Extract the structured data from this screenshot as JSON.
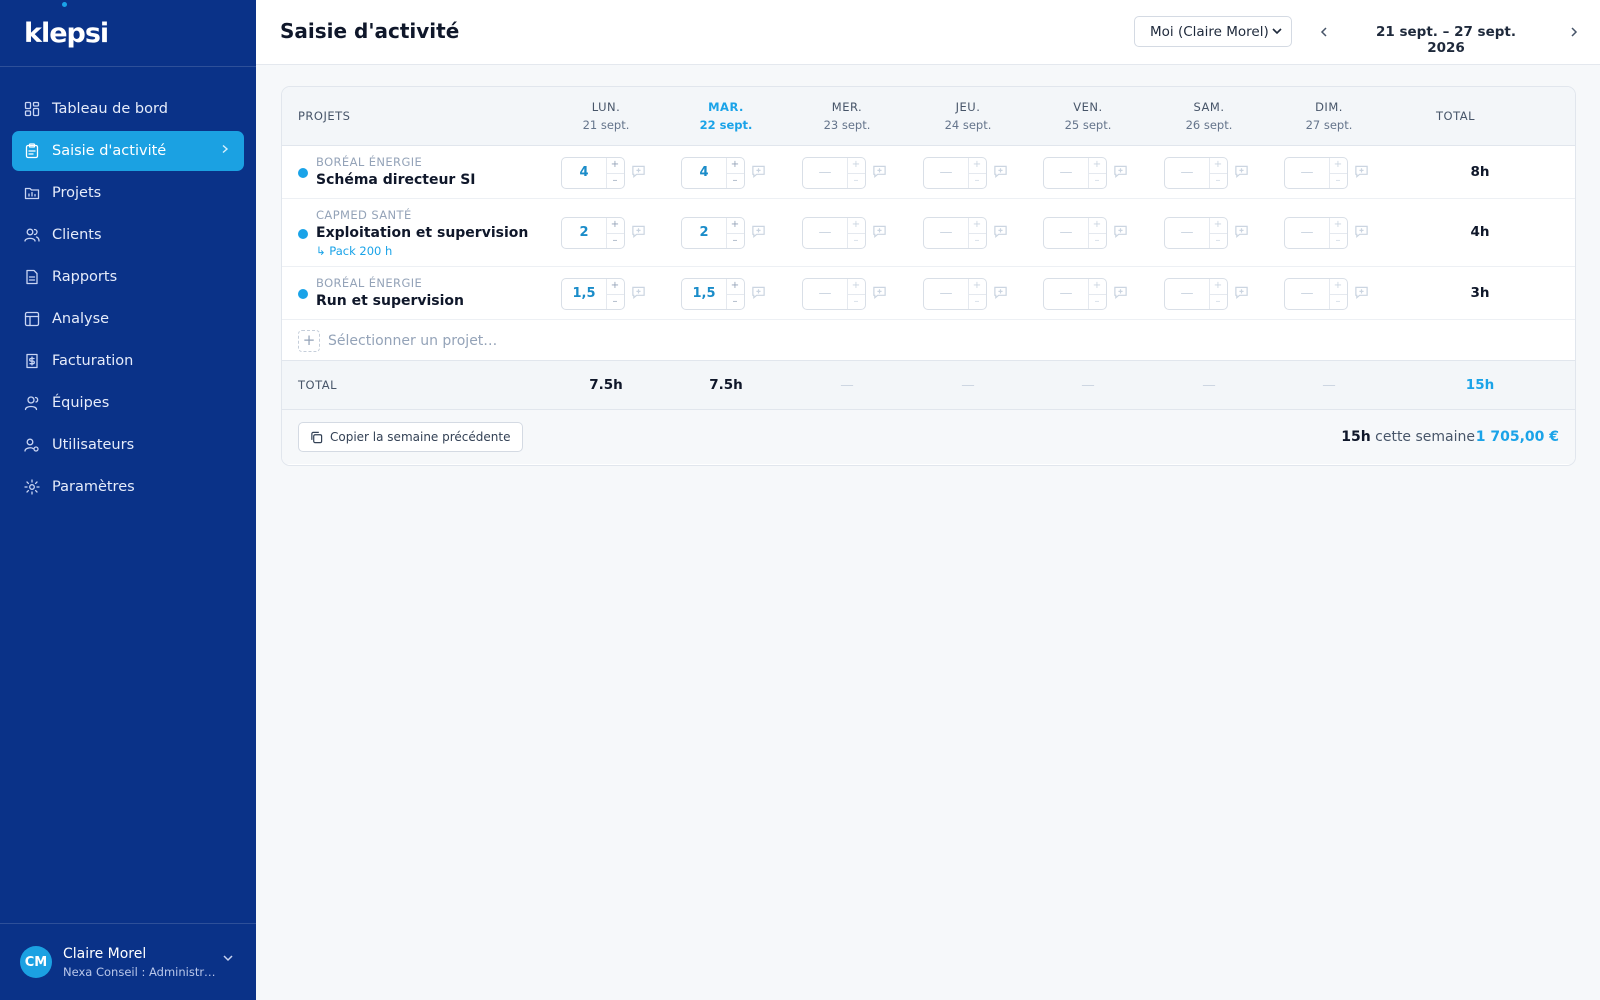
{
  "app": {
    "logo": "klepsi"
  },
  "sidebar": {
    "items": [
      {
        "label": "Tableau de bord",
        "icon": "dashboard-icon"
      },
      {
        "label": "Saisie d'activité",
        "icon": "clipboard-icon",
        "active": true
      },
      {
        "label": "Projets",
        "icon": "folder-chart-icon"
      },
      {
        "label": "Clients",
        "icon": "users-icon"
      },
      {
        "label": "Rapports",
        "icon": "report-icon"
      },
      {
        "label": "Analyse",
        "icon": "table-icon"
      },
      {
        "label": "Facturation",
        "icon": "invoice-icon"
      },
      {
        "label": "Équipes",
        "icon": "team-icon"
      },
      {
        "label": "Utilisateurs",
        "icon": "user-cog-icon"
      },
      {
        "label": "Paramètres",
        "icon": "gear-icon"
      }
    ],
    "user": {
      "initials": "CM",
      "name": "Claire Morel",
      "role": "Nexa Conseil : Administr…"
    }
  },
  "header": {
    "title": "Saisie d'activité",
    "person_select": "Moi (Claire Morel)",
    "date_range": "21 sept. – 27 sept. 2026"
  },
  "table": {
    "projects_header": "PROJETS",
    "total_header": "TOTAL",
    "days": [
      {
        "day": "LUN.",
        "date": "21 sept."
      },
      {
        "day": "MAR.",
        "date": "22 sept.",
        "today": true
      },
      {
        "day": "MER.",
        "date": "23 sept."
      },
      {
        "day": "JEU.",
        "date": "24 sept."
      },
      {
        "day": "VEN.",
        "date": "25 sept."
      },
      {
        "day": "SAM.",
        "date": "26 sept."
      },
      {
        "day": "DIM.",
        "date": "27 sept."
      }
    ],
    "rows": [
      {
        "client": "BORÉAL ÉNERGIE",
        "project": "Schéma directeur SI",
        "pack": "",
        "values": [
          "4",
          "4",
          "—",
          "—",
          "—",
          "—",
          "—"
        ],
        "total": "8h"
      },
      {
        "client": "CAPMED SANTÉ",
        "project": "Exploitation et supervision",
        "pack": "↳ Pack 200 h",
        "values": [
          "2",
          "2",
          "—",
          "—",
          "—",
          "—",
          "—"
        ],
        "total": "4h"
      },
      {
        "client": "BORÉAL ÉNERGIE",
        "project": "Run et supervision",
        "pack": "",
        "values": [
          "1,5",
          "1,5",
          "—",
          "—",
          "—",
          "—",
          "—"
        ],
        "total": "3h"
      }
    ],
    "add_project": "Sélectionner un projet…",
    "totals_label": "TOTAL",
    "day_totals": [
      "7.5h",
      "7.5h",
      "—",
      "—",
      "—",
      "—",
      "—"
    ],
    "grand_total": "15h"
  },
  "footer": {
    "copy_label": "Copier la semaine précédente",
    "week_hours": "15h",
    "week_suffix": "cette semaine",
    "week_amount": "1 705,00 €"
  },
  "colors": {
    "sidebar": "#0a3288",
    "accent": "#1aa3e8",
    "active_nav": "#1ba1e2"
  }
}
